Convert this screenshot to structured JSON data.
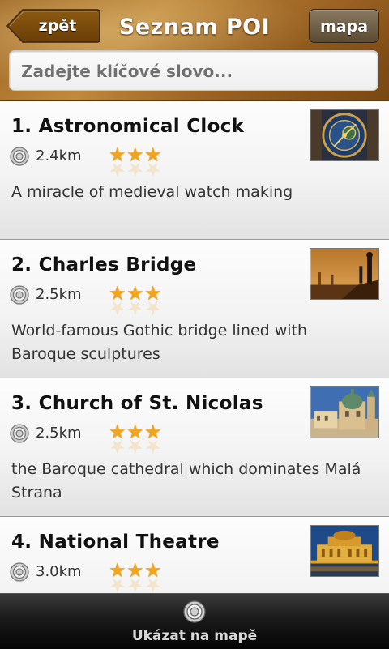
{
  "header": {
    "back_label": "zpět",
    "title": "Seznam POI",
    "map_label": "mapa"
  },
  "search": {
    "placeholder": "Zadejte klíčové slovo...",
    "value": ""
  },
  "pois": [
    {
      "title": "1. Astronomical Clock",
      "distance": "2.4km",
      "rating": 3,
      "description": "A miracle of medieval watch making",
      "thumbnail": "astronomical-clock-photo"
    },
    {
      "title": "2. Charles Bridge",
      "distance": "2.5km",
      "rating": 3,
      "description": "World-famous Gothic bridge lined with Baroque sculptures",
      "thumbnail": "charles-bridge-photo"
    },
    {
      "title": "3. Church of St. Nicolas",
      "distance": "2.5km",
      "rating": 3,
      "description": "the Baroque cathedral which dominates Malá Strana",
      "thumbnail": "church-st-nicolas-photo"
    },
    {
      "title": "4. National Theatre",
      "distance": "3.0km",
      "rating": 3,
      "description": "",
      "thumbnail": "national-theatre-photo"
    }
  ],
  "bottom_bar": {
    "label": "Ukázat na mapě",
    "icon": "target-icon"
  },
  "colors": {
    "header_brown": "#a46b28",
    "star_gold": "#f2a51a",
    "bottom_bar": "#1a1a1a"
  }
}
